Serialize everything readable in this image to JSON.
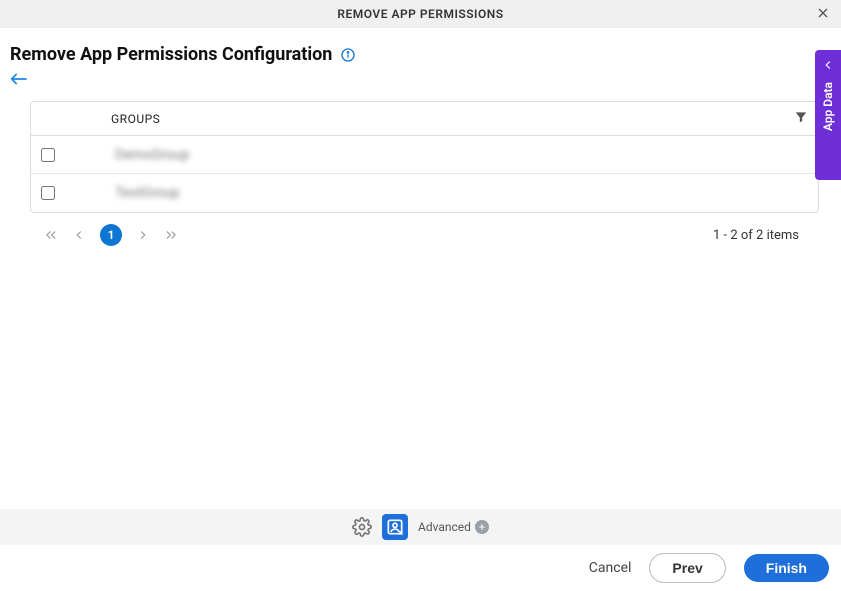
{
  "header": {
    "title": "REMOVE APP PERMISSIONS"
  },
  "section": {
    "title": "Remove App Permissions Configuration"
  },
  "table": {
    "column_header": "GROUPS",
    "rows": [
      {
        "label": "DemoGroup"
      },
      {
        "label": "TestGroup"
      }
    ]
  },
  "pager": {
    "current_page": "1",
    "summary": "1 - 2 of 2 items"
  },
  "side_tab": {
    "label": "App Data"
  },
  "toolbar": {
    "advanced_label": "Advanced"
  },
  "footer": {
    "cancel": "Cancel",
    "prev": "Prev",
    "finish": "Finish"
  }
}
